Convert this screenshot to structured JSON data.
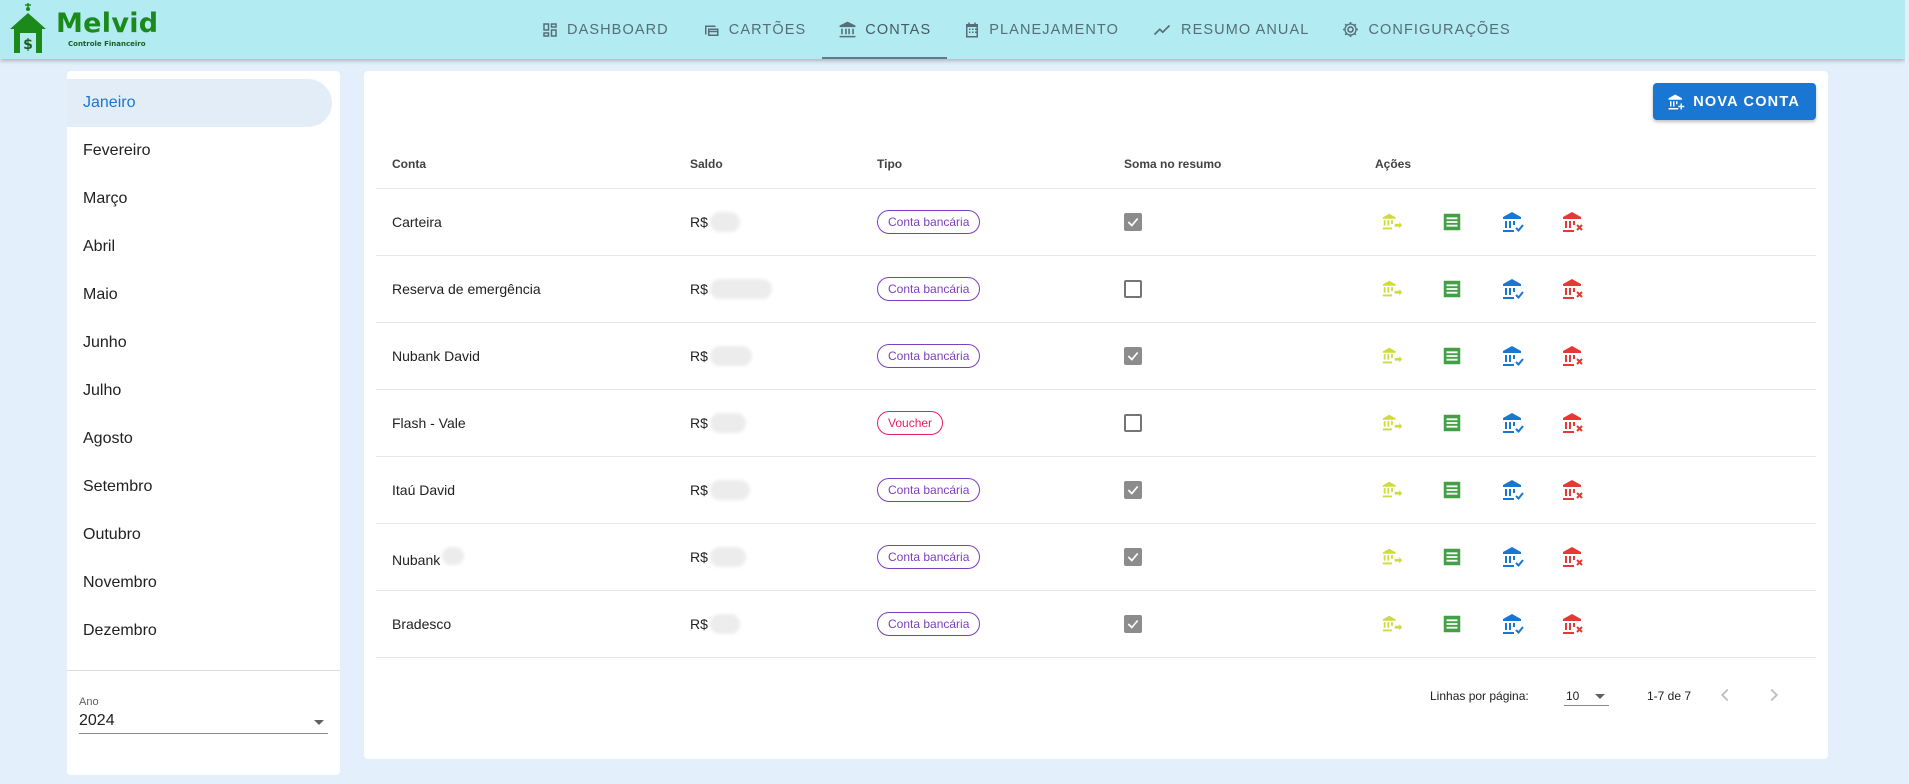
{
  "app": {
    "name": "Melvid",
    "subtitle": "Controle Financeiro"
  },
  "nav": [
    {
      "label": "DASHBOARD",
      "icon": "dashboard-icon"
    },
    {
      "label": "CARTÕES",
      "icon": "cards-icon"
    },
    {
      "label": "CONTAS",
      "icon": "bank-icon",
      "active": true
    },
    {
      "label": "PLANEJAMENTO",
      "icon": "calendar-icon"
    },
    {
      "label": "RESUMO ANUAL",
      "icon": "trending-icon"
    },
    {
      "label": "CONFIGURAÇÕES",
      "icon": "gear-icon"
    }
  ],
  "sidebar": {
    "months": [
      "Janeiro",
      "Fevereiro",
      "Março",
      "Abril",
      "Maio",
      "Junho",
      "Julho",
      "Agosto",
      "Setembro",
      "Outubro",
      "Novembro",
      "Dezembro"
    ],
    "selected_month": "Janeiro",
    "year_label": "Ano",
    "year_value": "2024"
  },
  "main": {
    "new_account_label": "NOVA CONTA",
    "columns": {
      "conta": "Conta",
      "saldo": "Saldo",
      "tipo": "Tipo",
      "soma": "Soma no resumo",
      "acoes": "Ações"
    },
    "rows": [
      {
        "conta": "Carteira",
        "currency": "R$",
        "tipo": "Conta bancária",
        "soma": true
      },
      {
        "conta": "Reserva de emergência",
        "currency": "R$",
        "tipo": "Conta bancária",
        "soma": false
      },
      {
        "conta": "Nubank David",
        "currency": "R$",
        "tipo": "Conta bancária",
        "soma": true
      },
      {
        "conta": "Flash - Vale",
        "currency": "R$",
        "tipo": "Voucher",
        "soma": false
      },
      {
        "conta": "Itaú David",
        "currency": "R$",
        "tipo": "Conta bancária",
        "soma": true
      },
      {
        "conta": "Nubank",
        "currency": "R$",
        "tipo": "Conta bancária",
        "soma": true
      },
      {
        "conta": "Bradesco",
        "currency": "R$",
        "tipo": "Conta bancária",
        "soma": true
      }
    ],
    "pagination": {
      "rows_per_page_label": "Linhas por página:",
      "rows_per_page": "10",
      "range": "1-7 de 7"
    }
  },
  "colors": {
    "topbar": "#b2ebf2",
    "accent": "#1976d2",
    "transfer_icon": "#cddc39",
    "statement_icon": "#43a047",
    "reconcile_icon": "#1976d2",
    "delete_icon": "#e53935",
    "chip_bank": "#7b3fbf",
    "chip_voucher": "#e91e63"
  }
}
